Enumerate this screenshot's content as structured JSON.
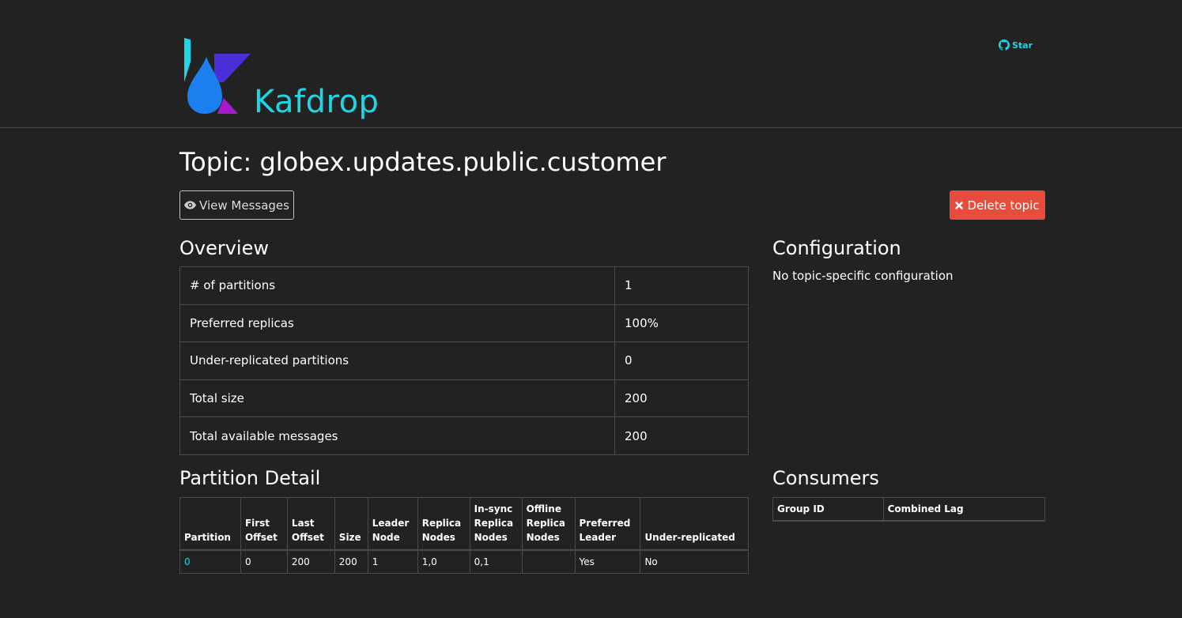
{
  "brand": {
    "name": "Kafdrop"
  },
  "github": {
    "icon": "github-icon",
    "label": "Star"
  },
  "page_title": "Topic: globex.updates.public.customer",
  "actions": {
    "view_messages": {
      "icon": "eye-icon",
      "label": "View Messages"
    },
    "delete_topic": {
      "icon": "close-icon",
      "label": "Delete topic",
      "color": "#e74c3c"
    }
  },
  "overview": {
    "title": "Overview",
    "rows": [
      {
        "label": "# of partitions",
        "value": "1"
      },
      {
        "label": "Preferred replicas",
        "value": "100%"
      },
      {
        "label": "Under-replicated partitions",
        "value": "0"
      },
      {
        "label": "Total size",
        "value": "200"
      },
      {
        "label": "Total available messages",
        "value": "200"
      }
    ]
  },
  "configuration": {
    "title": "Configuration",
    "text": "No topic-specific configuration"
  },
  "partition_detail": {
    "title": "Partition Detail",
    "headers": [
      "Partition",
      "First Offset",
      "Last Offset",
      "Size",
      "Leader Node",
      "Replica Nodes",
      "In-sync Replica Nodes",
      "Offline Replica Nodes",
      "Preferred Leader",
      "Under-replicated"
    ],
    "rows": [
      [
        "0",
        "0",
        "200",
        "200",
        "1",
        "1,0",
        "0,1",
        "",
        "Yes",
        "No"
      ]
    ]
  },
  "consumers": {
    "title": "Consumers",
    "headers": [
      "Group ID",
      "Combined Lag"
    ]
  },
  "colors": {
    "accent": "#1ed6e6",
    "background": "#222222",
    "danger": "#e74c3c"
  }
}
